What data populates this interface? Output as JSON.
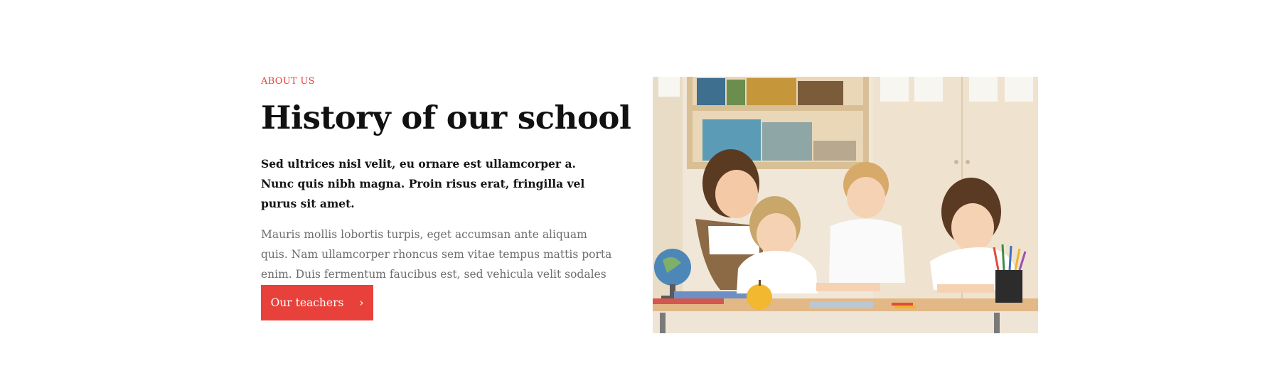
{
  "about": {
    "eyebrow": "ABOUT US",
    "title": "History of our school",
    "lead": "Sed ultrices nisl velit, eu ornare est ullamcorper a. Nunc quis nibh magna. Proin risus erat, fringilla vel purus sit amet.",
    "body": "Mauris mollis lobortis turpis, eget accumsan ante aliquam quis. Nam ullamcorper rhoncus sem vitae tempus mattis porta enim. Duis fermentum faucibus est, sed vehicula velit sodales vitae.",
    "button_label": "Our teachers",
    "button_icon": "chevron-right-icon"
  },
  "colors": {
    "accent": "#e8413b",
    "heading": "#111111",
    "muted_text": "#6d6d6d",
    "background": "#ffffff"
  }
}
